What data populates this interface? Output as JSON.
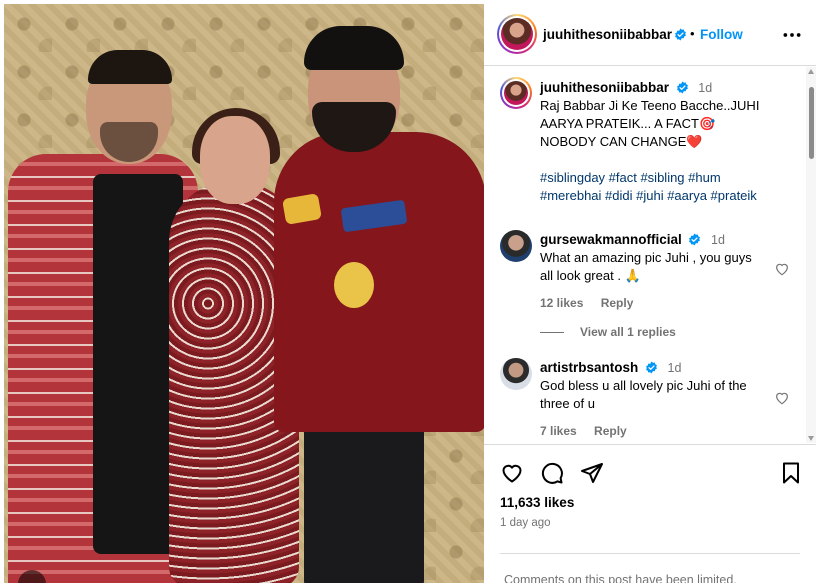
{
  "post": {
    "username": "juuhithesoniibabbar",
    "follow_label": "Follow",
    "separator": "•"
  },
  "caption": {
    "username": "juuhithesoniibabbar",
    "time": "1d",
    "text": "Raj Babbar Ji Ke Teeno Bacche..JUHI AARYA PRATEIK... A FACT🎯  NOBODY CAN CHANGE❤️",
    "hashtags": "#siblingday #fact #sibling #hum #merebhai #didi #juhi #aarya #prateik"
  },
  "comments": [
    {
      "username": "gursewakmannofficial",
      "time": "1d",
      "text": "What an amazing pic Juhi , you guys all look great . 🙏",
      "likes": "12 likes",
      "reply_label": "Reply"
    },
    {
      "username": "artistrbsantosh",
      "time": "1d",
      "text": "God bless u all lovely pic Juhi of the three of u",
      "likes": "7 likes",
      "reply_label": "Reply"
    }
  ],
  "view_replies": "View all 1 replies",
  "actions": {
    "likes_count": "11,633 likes",
    "posted": "1 day ago",
    "comments_notice": "Comments on this post have been limited."
  },
  "icons": {
    "verified": "verified-badge-icon",
    "more": "more-options-icon",
    "like": "heart-icon",
    "comment": "comment-icon",
    "share": "share-icon",
    "save": "bookmark-icon"
  },
  "colors": {
    "accent": "#0095f6",
    "muted": "#737373",
    "hashtag": "#00376b",
    "border": "#dbdbdb"
  }
}
